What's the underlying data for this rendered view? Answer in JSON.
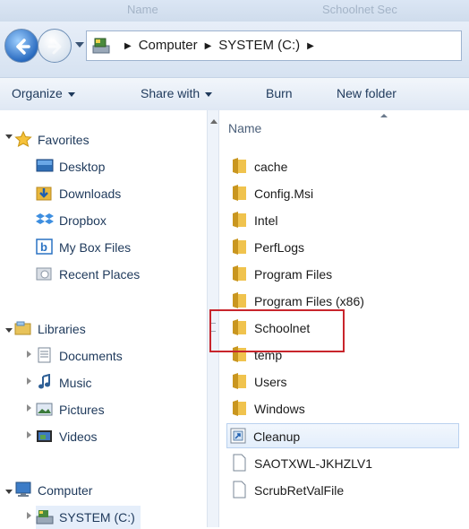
{
  "title_ghost": [
    "Name",
    "Schoolnet Sec"
  ],
  "address": {
    "crumbs": [
      "Computer",
      "SYSTEM (C:)"
    ]
  },
  "toolbar": {
    "organize": "Organize",
    "share_with": "Share with",
    "burn": "Burn",
    "new_folder": "New folder"
  },
  "nav": {
    "favorites": "Favorites",
    "desktop": "Desktop",
    "downloads": "Downloads",
    "dropbox": "Dropbox",
    "my_box_files": "My Box Files",
    "recent_places": "Recent Places",
    "libraries": "Libraries",
    "documents": "Documents",
    "music": "Music",
    "pictures": "Pictures",
    "videos": "Videos",
    "computer": "Computer",
    "system_c": "SYSTEM (C:)"
  },
  "files": {
    "header": "Name",
    "items": [
      "cache",
      "Config.Msi",
      "Intel",
      "PerfLogs",
      "Program Files",
      "Program Files (x86)",
      "Schoolnet",
      "temp",
      "Users",
      "Windows",
      "Cleanup",
      "SAOTXWL-JKHZLV1",
      "ScrubRetValFile"
    ]
  },
  "colors": {
    "highlight": "#c8252c",
    "folder": "#e8b73c",
    "text_nav": "#1e395b"
  },
  "icons": {
    "back": "back-arrow-icon",
    "forward": "forward-arrow-icon",
    "folder": "folder-icon",
    "file": "file-icon"
  }
}
